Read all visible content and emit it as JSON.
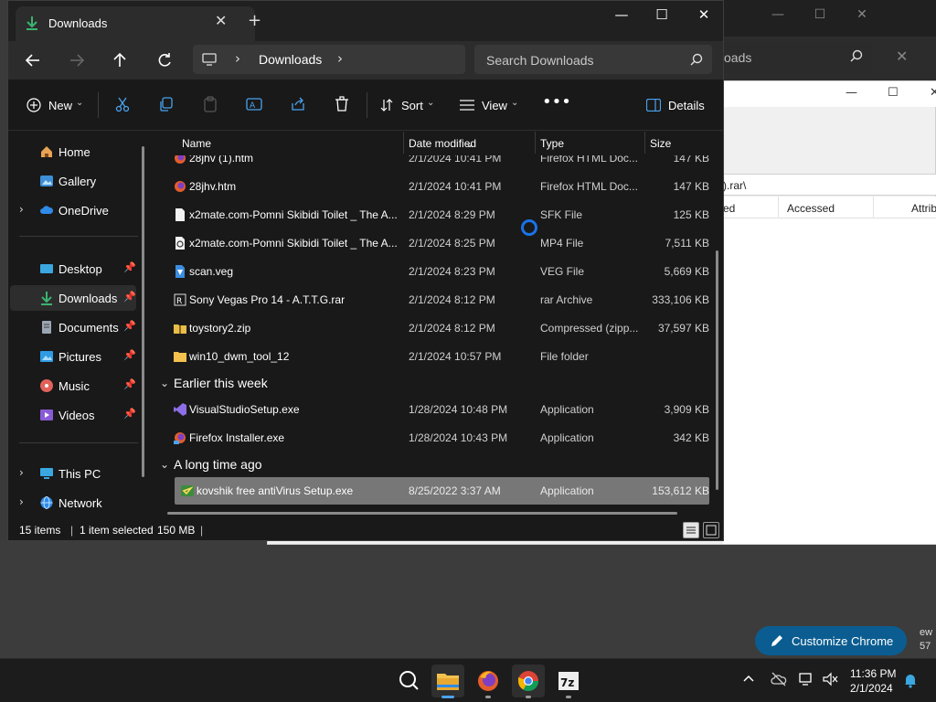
{
  "explorer": {
    "tab_title": "Downloads",
    "breadcrumb": "Downloads",
    "search_placeholder": "Search Downloads"
  },
  "toolbar": {
    "new_label": "New",
    "sort_label": "Sort",
    "view_label": "View",
    "details_label": "Details"
  },
  "sidebar": {
    "items": [
      {
        "label": "Home"
      },
      {
        "label": "Gallery"
      },
      {
        "label": "OneDrive"
      },
      {
        "label": "Desktop"
      },
      {
        "label": "Downloads"
      },
      {
        "label": "Documents"
      },
      {
        "label": "Pictures"
      },
      {
        "label": "Music"
      },
      {
        "label": "Videos"
      },
      {
        "label": "This PC"
      },
      {
        "label": "Network"
      }
    ]
  },
  "columns": {
    "name": "Name",
    "date": "Date modified",
    "type": "Type",
    "size": "Size"
  },
  "files": [
    {
      "name": "28jhv (1).htm",
      "date": "2/1/2024 10:41 PM",
      "type": "Firefox HTML Doc...",
      "size": "147 KB"
    },
    {
      "name": "28jhv.htm",
      "date": "2/1/2024 10:41 PM",
      "type": "Firefox HTML Doc...",
      "size": "147 KB"
    },
    {
      "name": "x2mate.com-Pomni Skibidi Toilet _ The A...",
      "date": "2/1/2024 8:29 PM",
      "type": "SFK File",
      "size": "125 KB"
    },
    {
      "name": "x2mate.com-Pomni Skibidi Toilet _ The A...",
      "date": "2/1/2024 8:25 PM",
      "type": "MP4 File",
      "size": "7,511 KB"
    },
    {
      "name": "scan.veg",
      "date": "2/1/2024 8:23 PM",
      "type": "VEG File",
      "size": "5,669 KB"
    },
    {
      "name": "Sony Vegas Pro 14 - A.T.T.G.rar",
      "date": "2/1/2024 8:12 PM",
      "type": "rar Archive",
      "size": "333,106 KB"
    },
    {
      "name": "toystory2.zip",
      "date": "2/1/2024 8:12 PM",
      "type": "Compressed (zipp...",
      "size": "37,597 KB"
    },
    {
      "name": "win10_dwm_tool_12",
      "date": "2/1/2024 10:57 PM",
      "type": "File folder",
      "size": ""
    }
  ],
  "groups": {
    "week": "Earlier this week",
    "old": "A long time ago"
  },
  "files_week": [
    {
      "name": "VisualStudioSetup.exe",
      "date": "1/28/2024 10:48 PM",
      "type": "Application",
      "size": "3,909 KB"
    },
    {
      "name": "Firefox Installer.exe",
      "date": "1/28/2024 10:43 PM",
      "type": "Application",
      "size": "342 KB"
    }
  ],
  "files_old": [
    {
      "name": "kovshik free antiVirus Setup.exe",
      "date": "8/25/2022 3:37 AM",
      "type": "Application",
      "size": "153,612 KB"
    }
  ],
  "status": {
    "count": "15 items",
    "selected": "1 item selected",
    "size": "150 MB"
  },
  "background_window": {
    "search_text": "oads",
    "path_text": ").rar\\",
    "col_partial": "ed",
    "col_accessed": "Accessed",
    "col_attrib": "Attrib"
  },
  "chrome": {
    "customize_label": "Customize Chrome",
    "edge_text_1": "ew",
    "edge_text_2": "57"
  },
  "clock": {
    "time": "11:36 PM",
    "date": "2/1/2024"
  },
  "colors": {
    "accent": "#1a73e8",
    "selected_row": "#777777",
    "customize": "#0b5d91"
  }
}
